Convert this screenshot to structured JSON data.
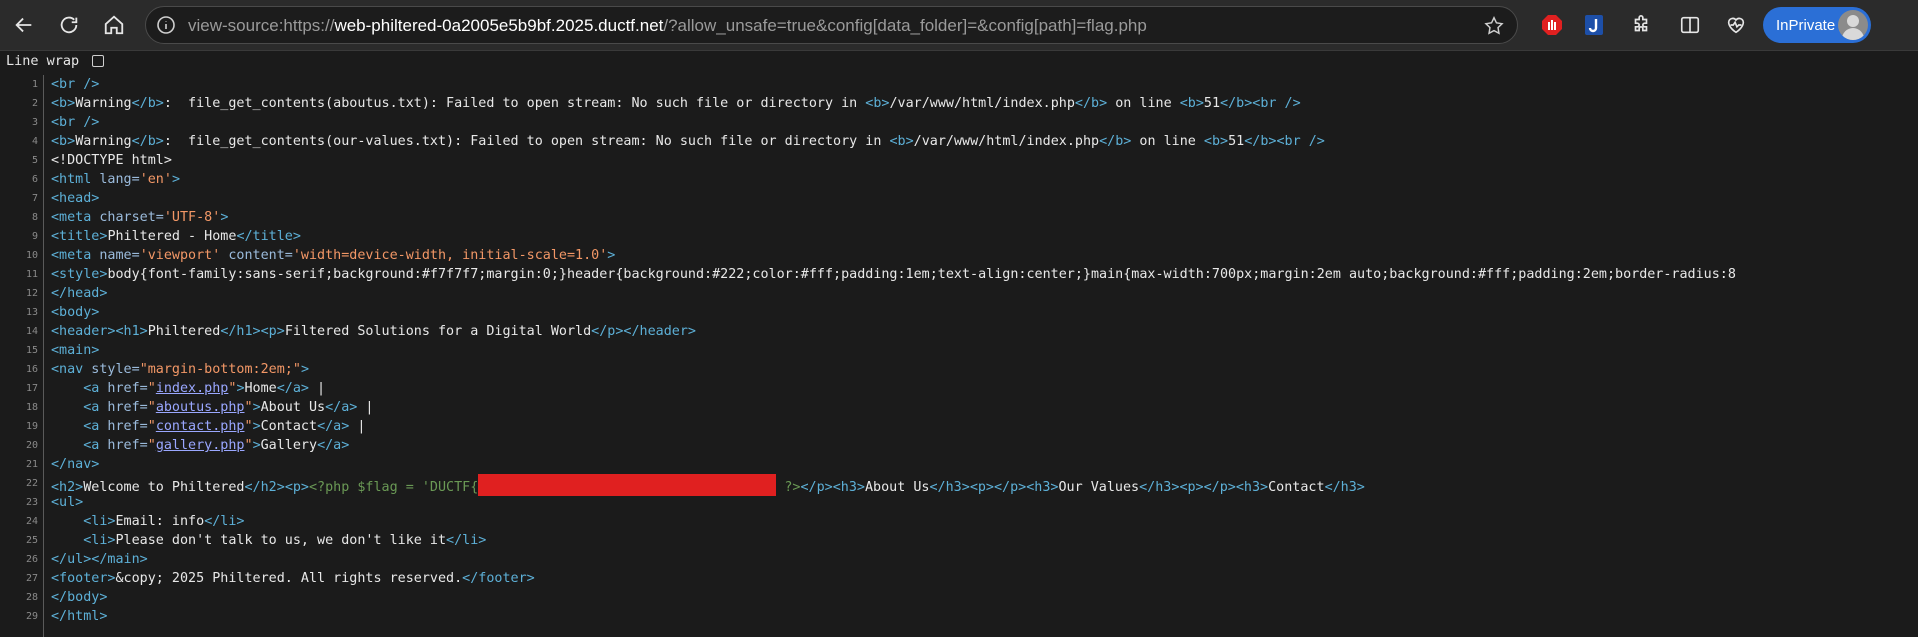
{
  "browser": {
    "url_prefix": "view-source:https://",
    "url_host": "web-philtered-0a2005e5b9bf.2025.ductf.net",
    "url_rest": "/?allow_unsafe=true&config[data_folder]=&config[path]=flag.php",
    "inprivate_label": "InPrivate",
    "icons": [
      "back-icon",
      "refresh-icon",
      "home-icon",
      "info-icon",
      "star-icon",
      "stop-extension-icon",
      "j-extension-icon",
      "extensions-icon",
      "split-screen-icon",
      "health-icon",
      "avatar"
    ]
  },
  "viewer": {
    "line_wrap_label": "Line wrap",
    "line_wrap_checked": false
  },
  "source": {
    "line_numbers": [
      "1",
      "2",
      "3",
      "4",
      "5",
      "6",
      "7",
      "8",
      "9",
      "10",
      "11",
      "12",
      "13",
      "14",
      "15",
      "16",
      "17",
      "18",
      "19",
      "20",
      "21",
      "22",
      "23",
      "24",
      "25",
      "26",
      "27",
      "28",
      "29"
    ],
    "l1": "<br />",
    "l2_b_open": "<b>",
    "l2_warn": "Warning",
    "l2_b_close": "</b>",
    "l2_msg": ":  file_get_contents(aboutus.txt): Failed to open stream: No such file or directory in ",
    "l2_path": "/var/www/html/index.php",
    "l2_online": " on line ",
    "l2_num": "51",
    "l3": "<br />",
    "l4_msg": ":  file_get_contents(our-values.txt): Failed to open stream: No such file or directory in ",
    "l5": "<!DOCTYPE html>",
    "l6_tag": "<html",
    "l6_attr": " lang=",
    "l6_val": "'en'",
    "l6_end": ">",
    "l7": "<head>",
    "l8_tag": "<meta",
    "l8_attr": " charset=",
    "l8_val": "'UTF-8'",
    "l8_end": ">",
    "l9_open": "<title>",
    "l9_text": "Philtered - Home",
    "l9_close": "</title>",
    "l10_tag": "<meta",
    "l10_attr1": " name=",
    "l10_val1": "'viewport'",
    "l10_attr2": " content=",
    "l10_val2": "'width=device-width, initial-scale=1.0'",
    "l10_end": ">",
    "l11_open": "<style>",
    "l11_text": "body{font-family:sans-serif;background:#f7f7f7;margin:0;}header{background:#222;color:#fff;padding:1em;text-align:center;}main{max-width:700px;margin:2em auto;background:#fff;padding:2em;border-radius:8",
    "l12": "</head>",
    "l13": "<body>",
    "l14_h": "<header>",
    "l14_h1": "<h1>",
    "l14_t1": "Philtered",
    "l14_h1c": "</h1>",
    "l14_p": "<p>",
    "l14_t2": "Filtered Solutions for a Digital World",
    "l14_pc": "</p>",
    "l14_hc": "</header>",
    "l15": "<main>",
    "l16_tag": "<nav",
    "l16_attr": " style=",
    "l16_val": "\"margin-bottom:2em;\"",
    "l16_end": ">",
    "nav_links": [
      {
        "href": "index.php",
        "text": "Home",
        "sep": " |"
      },
      {
        "href": "aboutus.php",
        "text": "About Us",
        "sep": " |"
      },
      {
        "href": "contact.php",
        "text": "Contact",
        "sep": " |"
      },
      {
        "href": "gallery.php",
        "text": "Gallery",
        "sep": ""
      }
    ],
    "a_open": "<a",
    "a_attr": " href=",
    "a_end": ">",
    "a_close": "</a>",
    "indent": "    ",
    "l21": "</nav>",
    "l22_h2": "<h2>",
    "l22_t1": "Welcome to Philtered",
    "l22_h2c": "</h2>",
    "l22_p": "<p>",
    "l22_php": "<?php $flag = 'DUCTF{",
    "l22_php_end": "?>",
    "l22_pc": "</p>",
    "l22_h3": "<h3>",
    "l22_t2": "About Us",
    "l22_h3c": "</h3>",
    "l22_t3": "Our Values",
    "l22_t4": "Contact",
    "l23": "<ul>",
    "l24_li": "<li>",
    "l24_text": "Email: info",
    "l24_lic": "</li>",
    "l25_text": "Please don't talk to us, we don't like it",
    "l26": "</ul></main>",
    "l27_open": "<footer>",
    "l27_text": "&copy; 2025 Philtered. All rights reserved.",
    "l27_close": "</footer>",
    "l28": "</body>",
    "l29": "</html>"
  }
}
